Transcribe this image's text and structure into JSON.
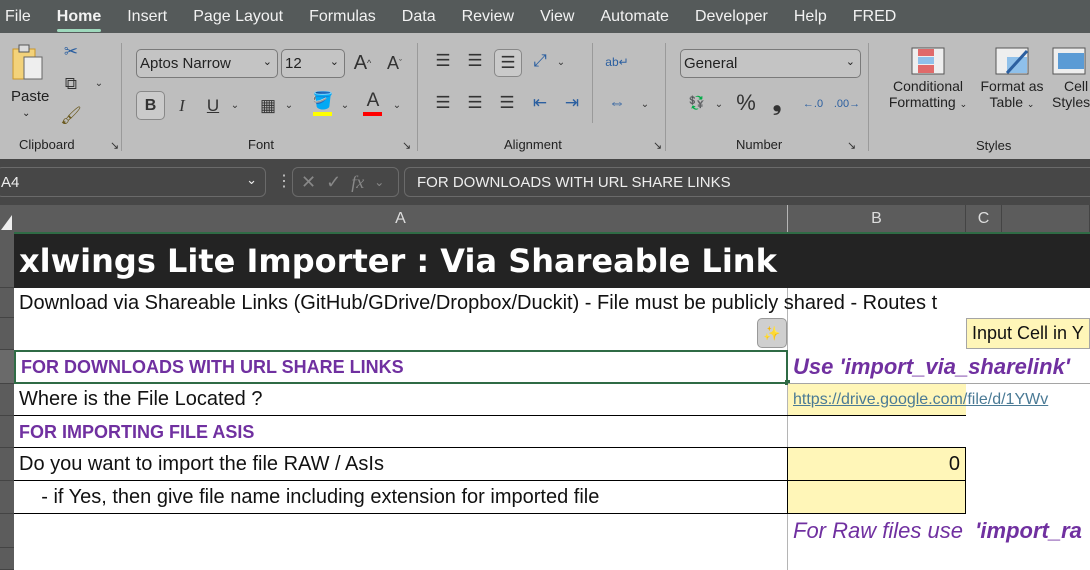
{
  "menu": [
    "File",
    "Home",
    "Insert",
    "Page Layout",
    "Formulas",
    "Data",
    "Review",
    "View",
    "Automate",
    "Developer",
    "Help",
    "FRED"
  ],
  "ribbon": {
    "clipboard": {
      "label": "Clipboard",
      "paste": "Paste"
    },
    "font": {
      "label": "Font",
      "font_name": "Aptos Narrow",
      "font_size": "12",
      "bold": "B",
      "italic": "I",
      "underline": "U",
      "fill_color": "#ffff00",
      "font_color": "#ff0000"
    },
    "alignment": {
      "label": "Alignment"
    },
    "number": {
      "label": "Number",
      "format": "General",
      "percent": "%",
      "comma": "❟"
    },
    "styles": {
      "label": "Styles",
      "conditional": "Conditional",
      "conditional2": "Formatting",
      "format_table": "Format as",
      "format_table2": "Table",
      "cell_styles": "Cell",
      "cell_styles2": "Styles"
    }
  },
  "formula_bar": {
    "name_box": "A4",
    "formula": "FOR DOWNLOADS WITH URL SHARE LINKS"
  },
  "columns": [
    "A",
    "B",
    "C"
  ],
  "cells": {
    "a1": "xlwings Lite Importer : Via Shareable Link",
    "a2": "Download via Shareable Links (GitHub/GDrive/Dropbox/Duckit) - File must be publicly shared - Routes t",
    "c3": "Input Cell in Y",
    "a4": "FOR DOWNLOADS WITH URL SHARE LINKS",
    "b4": "Use 'import_via_sharelink'",
    "a5": "Where is the File Located ?",
    "b5": "https://drive.google.com/file/d/1YWv",
    "a6": "FOR IMPORTING FILE ASIS",
    "a7": "Do you want to import the file RAW / AsIs",
    "b7": "0",
    "a8": "    - if Yes, then give file name including extension for imported file",
    "b9a": "For Raw files use ",
    "b9b": " 'import_ra"
  }
}
